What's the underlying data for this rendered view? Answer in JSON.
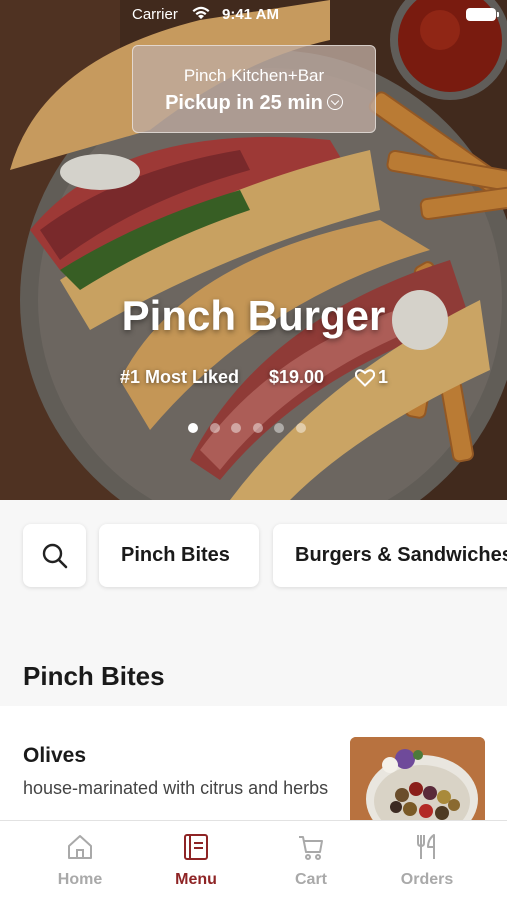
{
  "status_bar": {
    "carrier": "Carrier",
    "time": "9:41 AM"
  },
  "pickup": {
    "restaurant": "Pinch Kitchen+Bar",
    "eta": "Pickup in 25 min"
  },
  "hero": {
    "title": "Pinch Burger",
    "tag": "#1 Most Liked",
    "price": "$19.00",
    "likes": "1",
    "carousel": {
      "count": 6,
      "active": 0
    }
  },
  "categories": {
    "search_icon": "search-icon",
    "chips": [
      "Pinch Bites",
      "Burgers & Sandwiches"
    ]
  },
  "section": {
    "title": "Pinch Bites"
  },
  "menu_items": [
    {
      "name": "Olives",
      "description": "house-marinated with citrus and herbs"
    }
  ],
  "tabs": [
    {
      "label": "Home",
      "icon": "home-icon"
    },
    {
      "label": "Menu",
      "icon": "menu-book-icon"
    },
    {
      "label": "Cart",
      "icon": "cart-icon"
    },
    {
      "label": "Orders",
      "icon": "fork-knife-icon"
    }
  ],
  "colors": {
    "accent": "#8e2425",
    "inactive": "#a9a9a9"
  }
}
